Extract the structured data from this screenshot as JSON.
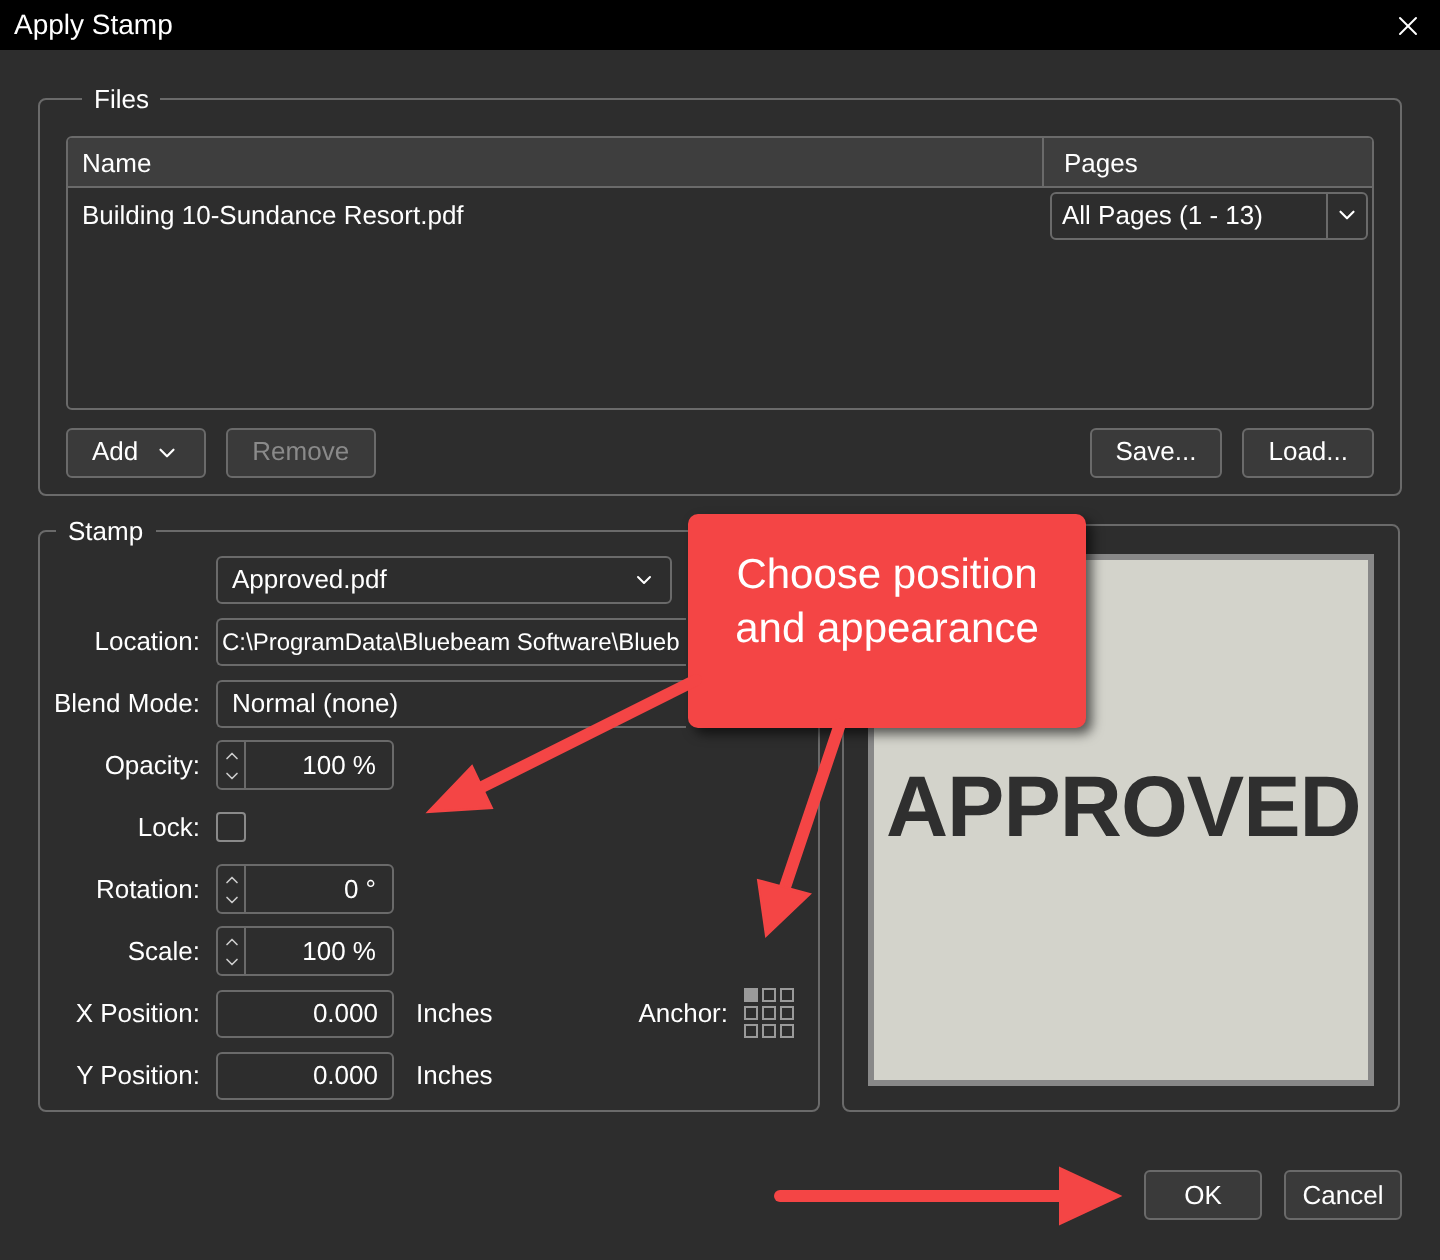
{
  "window": {
    "title": "Apply Stamp"
  },
  "files": {
    "legend": "Files",
    "columns": [
      "Name",
      "Pages"
    ],
    "rows": [
      {
        "name": "Building 10-Sundance Resort.pdf",
        "pages": "All Pages (1 - 13)"
      }
    ],
    "left_buttons": [
      {
        "label": "Add",
        "menu": true,
        "disabled": false
      },
      {
        "label": "Remove",
        "menu": false,
        "disabled": true
      }
    ],
    "right_buttons": [
      {
        "label": "Save...",
        "menu": false,
        "disabled": false
      },
      {
        "label": "Load...",
        "menu": false,
        "disabled": false
      }
    ]
  },
  "stamp": {
    "legend": "Stamp",
    "file": "Approved.pdf",
    "rows": [
      {
        "kind": "text",
        "label": "Location:",
        "value": "C:\\ProgramData\\Bluebeam Software\\Blueb"
      },
      {
        "kind": "select",
        "label": "Blend Mode:",
        "value": "Normal (none)"
      },
      {
        "kind": "spinner",
        "label": "Opacity:",
        "value": "100 %"
      },
      {
        "kind": "checkbox",
        "label": "Lock:",
        "checked": false
      },
      {
        "kind": "spinner",
        "label": "Rotation:",
        "value": "0 °"
      },
      {
        "kind": "spinner",
        "label": "Scale:",
        "value": "100 %"
      },
      {
        "kind": "number",
        "label": "X Position:",
        "value": "0.000",
        "unit": "Inches"
      },
      {
        "kind": "number",
        "label": "Y Position:",
        "value": "0.000",
        "unit": "Inches"
      }
    ],
    "anchor": {
      "label": "Anchor:",
      "cells": [
        {
          "selected": true
        },
        {
          "selected": false
        },
        {
          "selected": false
        },
        {
          "selected": false
        },
        {
          "selected": false
        },
        {
          "selected": false
        },
        {
          "selected": false
        },
        {
          "selected": false
        },
        {
          "selected": false
        }
      ]
    }
  },
  "preview": {
    "text": "APPROVED"
  },
  "callout": {
    "lines": [
      "Choose position",
      "and appearance"
    ]
  },
  "buttons": [
    {
      "label": "OK"
    },
    {
      "label": "Cancel"
    }
  ]
}
